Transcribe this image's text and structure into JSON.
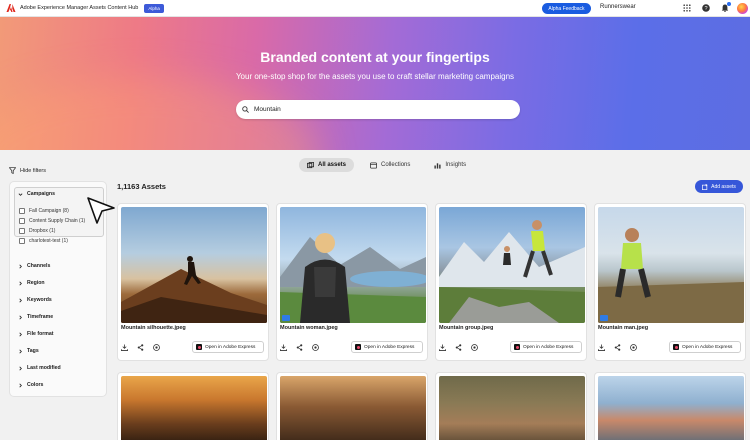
{
  "topbar": {
    "app_title": "Adobe Experience Manager Assets Content Hub",
    "alpha_badge": "Alpha",
    "feedback_label": "Alpha Feedback",
    "org_name": "Runnerswear",
    "icons": [
      "apps-grid-icon",
      "help-icon",
      "bell-icon",
      "user-avatar"
    ]
  },
  "hero": {
    "title": "Branded content at your fingertips",
    "subtitle": "Your one-stop shop for the assets you use to craft stellar marketing campaigns",
    "search_value": "Mountain"
  },
  "tabs": [
    {
      "label": "All assets",
      "active": true
    },
    {
      "label": "Collections",
      "active": false
    },
    {
      "label": "Insights",
      "active": false
    }
  ],
  "filters": {
    "hide_label": "Hide filters",
    "campaigns_label": "Campaigns",
    "campaign_options": [
      "Fall Campaign (8)",
      "Content Supply Chain (1)",
      "Dropbox (1)",
      "charlotest-test (1)"
    ],
    "groups": [
      "Channels",
      "Region",
      "Keywords",
      "Timeframe",
      "File format",
      "Tags",
      "Last modified",
      "Colors"
    ]
  },
  "assets": {
    "count_label": "1,1163 Assets",
    "add_label": "Add assets",
    "open_label": "Open in Adobe Express",
    "cards": [
      {
        "name": "Mountain silhouette.jpeg"
      },
      {
        "name": "Mountain woman.jpeg"
      },
      {
        "name": "Mountain group.jpeg"
      },
      {
        "name": "Mountain man.jpeg"
      }
    ]
  },
  "colors": {
    "accent": "#1a5ce0",
    "add_button": "#3657d9",
    "page_bg": "#f1f1f1"
  }
}
